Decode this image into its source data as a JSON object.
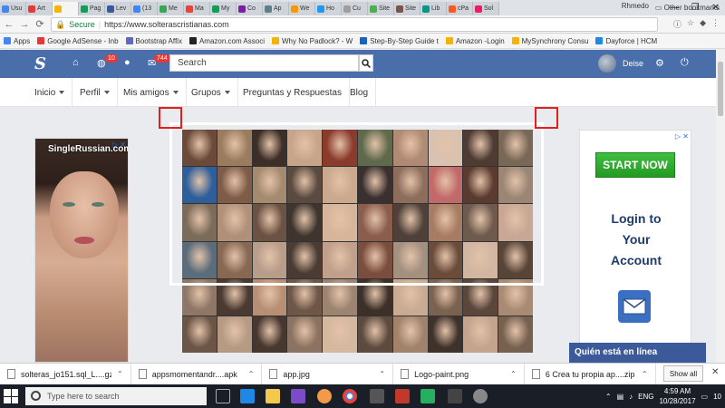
{
  "browser": {
    "tabs": [
      "Usu",
      "Art",
      "",
      "Pag",
      "Lev",
      "(13",
      "Me",
      "Ma",
      "My",
      "Co",
      "Ap",
      "We",
      "Ho",
      "Cu",
      "Site",
      "Site",
      "Lib",
      "cPa",
      "Sol"
    ],
    "profile_name": "Rhmedo",
    "secure_label": "Secure",
    "url": "https://www.solterascristianas.com",
    "bookmarks": [
      "Apps",
      "Google AdSense - Inb",
      "Bootstrap Affix",
      "Amazon.com Associ",
      "Why No Padlock? - W",
      "Step-By-Step Guide t",
      "Amazon -Login",
      "MySynchrony Consu",
      "Dayforce | HCM"
    ],
    "other_bookmarks": "Other bookmarks"
  },
  "site": {
    "logo": "S",
    "notif_badge": "10",
    "messages_badge": "744",
    "search_placeholder": "Search",
    "user_name": "Deise",
    "menu": [
      {
        "label": "Inicio",
        "dropdown": true
      },
      {
        "label": "Perfil",
        "dropdown": true
      },
      {
        "label": "Mis amigos",
        "dropdown": true
      },
      {
        "label": "Grupos",
        "dropdown": true
      },
      {
        "label": "Preguntas y Respuestas",
        "dropdown": false
      },
      {
        "label": "Blog",
        "dropdown": false
      }
    ]
  },
  "ads": {
    "left_brand": "SingleRussian.com",
    "right_button": "START NOW",
    "right_text_lines": [
      "Login to",
      "Your",
      "Account"
    ],
    "adchoice": "▷ ✕"
  },
  "online": {
    "label": "Quién está en línea"
  },
  "collage": {
    "tile_colors": [
      "#6b4a3a",
      "#9a7c5e",
      "#3d2e28",
      "#c7a58a",
      "#8b3b2c",
      "#5f6a4c",
      "#b08a72",
      "#d9c2b0",
      "#4e3b33",
      "#7a6857",
      "#2f5f9a",
      "#7e5c48",
      "#a48a6e",
      "#5b4a40",
      "#caa98e",
      "#3a3030",
      "#8d6e5c",
      "#c26a6a",
      "#5b3b2f",
      "#9b8575",
      "#7b6b5a",
      "#b09078",
      "#6c5242",
      "#3f352e",
      "#d6b59b",
      "#8a5d4d",
      "#4f4039",
      "#a77c62",
      "#6e5b4e",
      "#c8a894",
      "#5b6c7b",
      "#876853",
      "#b89d8a",
      "#4a3c33",
      "#c0a08a",
      "#7b4d3e",
      "#a3907f",
      "#6a4c3b",
      "#d1b7a2",
      "#574537",
      "#8e7766",
      "#4b3a32",
      "#b88f74",
      "#6f5748",
      "#9d8470",
      "#3c3029",
      "#c9ab93",
      "#7a6250",
      "#5a463b",
      "#a98b74",
      "#6b5546",
      "#b69a84",
      "#47372f",
      "#8c7260",
      "#d4b8a0",
      "#5e4a3e",
      "#a1836c",
      "#3f322b",
      "#c4a48c",
      "#76604f"
    ]
  },
  "downloads": {
    "items": [
      "solteras_jo151.sql_L....gz",
      "appsmomentandr....apk",
      "app.jpg",
      "Logo-paint.png",
      "6 Crea tu propia ap....zip"
    ],
    "show_all": "Show all"
  },
  "taskbar": {
    "search_placeholder": "Type here to search",
    "time": "4:59 AM",
    "date": "10/28/2017",
    "notif_count": "10",
    "ime": "ENG"
  }
}
